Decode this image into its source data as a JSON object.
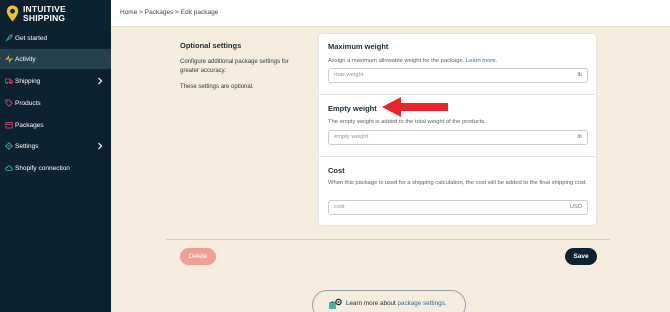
{
  "brand": {
    "line1": "INTUITIVE",
    "line2": "SHIPPING"
  },
  "nav": [
    {
      "label": "Get started",
      "icon": "rocket-icon"
    },
    {
      "label": "Activity",
      "icon": "activity-icon",
      "active": true
    },
    {
      "label": "Shipping",
      "icon": "truck-icon",
      "has_submenu": true
    },
    {
      "label": "Products",
      "icon": "tag-icon"
    },
    {
      "label": "Packages",
      "icon": "package-icon"
    },
    {
      "label": "Settings",
      "icon": "gear-icon",
      "has_submenu": true
    },
    {
      "label": "Shopify connection",
      "icon": "cloud-icon"
    }
  ],
  "breadcrumb": {
    "home": "Home",
    "packages": "Packages",
    "current": "Edit package",
    "separator": ">"
  },
  "optional": {
    "title": "Optional settings",
    "description": "Configure additional package settings for greater accuracy.",
    "note": "These settings are optional."
  },
  "max_weight": {
    "title": "Maximum weight",
    "description": "Assign a maximum allowable weight for the package.",
    "link": "Learn more.",
    "placeholder": "max weight",
    "unit": "lb"
  },
  "empty_weight": {
    "title": "Empty weight",
    "description": "The empty weight is added to the total weight of the products.",
    "placeholder": "empty weight",
    "unit": "lb"
  },
  "cost": {
    "title": "Cost",
    "description": "When this package is used for a shipping calculation, the cost will be added to the final shipping cost.",
    "placeholder": "cost",
    "unit": "USD"
  },
  "actions": {
    "delete": "Delete",
    "save": "Save"
  },
  "learn_more": {
    "prefix": "Learn more about",
    "link": "package settings."
  },
  "colors": {
    "sidebar": "#0c2230",
    "accent_gold": "#f2c028",
    "arrow_red": "#e8262a",
    "delete_button": "#ee9f96",
    "link": "#2f6f9a"
  }
}
